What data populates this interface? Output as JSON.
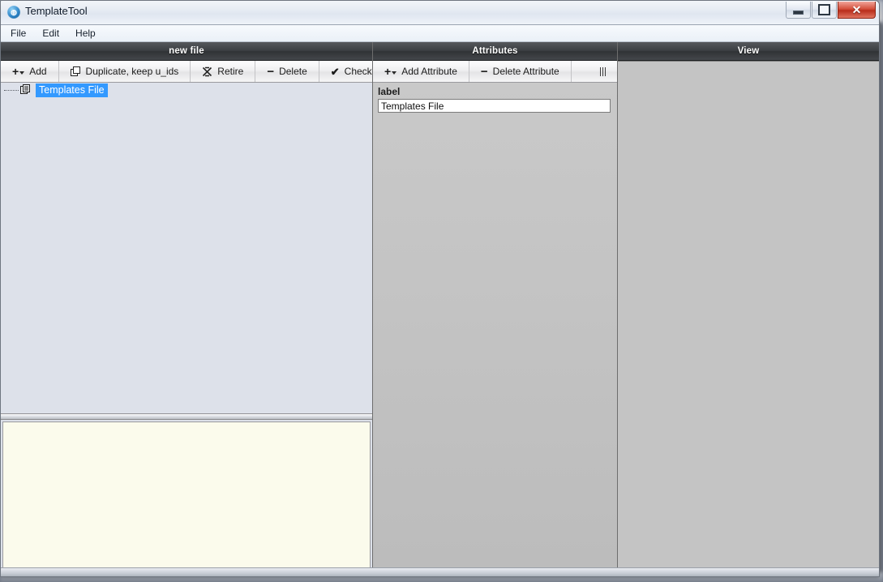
{
  "window": {
    "title": "TemplateTool",
    "app_icon": "globe-icon",
    "controls": {
      "minimize": "minimize-icon",
      "maximize": "maximize-icon",
      "close": "✕"
    }
  },
  "menubar": {
    "items": [
      {
        "label": "File"
      },
      {
        "label": "Edit"
      },
      {
        "label": "Help"
      }
    ]
  },
  "left_panel": {
    "header": "new file",
    "toolbar": [
      {
        "label": "Add",
        "icon": "plus-dropdown-icon"
      },
      {
        "label": "Duplicate, keep u_ids",
        "icon": "copy-icon"
      },
      {
        "label": "Retire",
        "icon": "retire-icon"
      },
      {
        "label": "Delete",
        "icon": "minus-icon"
      },
      {
        "label": "Check L",
        "icon": "check-icon"
      }
    ],
    "tree": [
      {
        "label": "Templates File",
        "icon": "layers-icon",
        "selected": true
      }
    ],
    "console_text": ""
  },
  "attributes_panel": {
    "header": "Attributes",
    "toolbar": [
      {
        "label": "Add Attribute",
        "icon": "plus-dropdown-icon"
      },
      {
        "label": "Delete Attribute",
        "icon": "minus-icon"
      }
    ],
    "grip": "resize-grip-icon",
    "fields": [
      {
        "label": "label",
        "value": "Templates File",
        "placeholder": ""
      }
    ]
  },
  "view_panel": {
    "header": "View"
  },
  "colors": {
    "selection": "#3399ff",
    "header_bar": "#3b3e42",
    "tree_background": "#dde1ea",
    "attributes_background": "#c4c4c4",
    "console_background": "#fbfbec",
    "close_button": "#c4391f"
  }
}
